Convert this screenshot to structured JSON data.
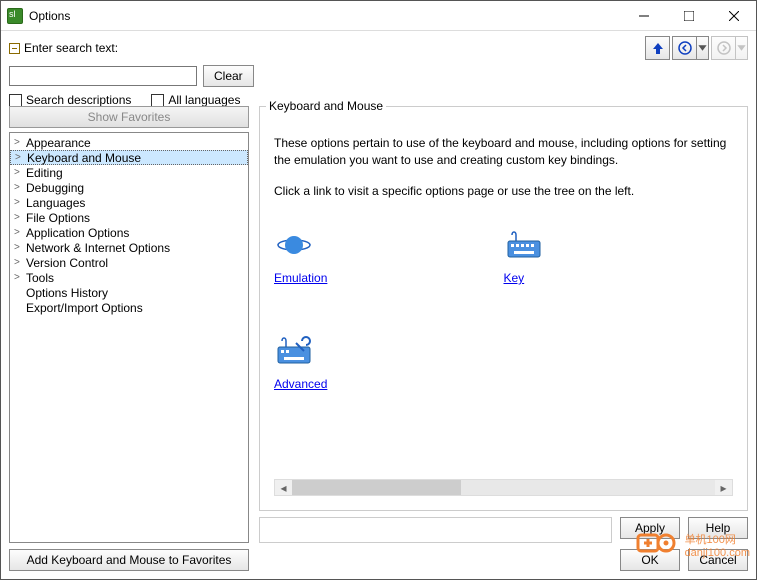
{
  "window": {
    "title": "Options"
  },
  "search": {
    "label": "Enter search text:",
    "clear": "Clear",
    "desc_chk": "Search descriptions",
    "lang_chk": "All languages",
    "favorites_btn": "Show Favorites",
    "add_fav_btn": "Add Keyboard and Mouse to Favorites"
  },
  "tree": [
    {
      "label": "Appearance",
      "expandable": true,
      "selected": false
    },
    {
      "label": "Keyboard and Mouse",
      "expandable": true,
      "selected": true
    },
    {
      "label": "Editing",
      "expandable": true,
      "selected": false
    },
    {
      "label": "Debugging",
      "expandable": true,
      "selected": false
    },
    {
      "label": "Languages",
      "expandable": true,
      "selected": false
    },
    {
      "label": "File Options",
      "expandable": true,
      "selected": false
    },
    {
      "label": "Application Options",
      "expandable": true,
      "selected": false
    },
    {
      "label": "Network & Internet Options",
      "expandable": true,
      "selected": false
    },
    {
      "label": "Version Control",
      "expandable": true,
      "selected": false
    },
    {
      "label": "Tools",
      "expandable": true,
      "selected": false
    },
    {
      "label": "Options History",
      "expandable": false,
      "selected": false
    },
    {
      "label": "Export/Import Options",
      "expandable": false,
      "selected": false
    }
  ],
  "panel": {
    "title": "Keyboard and Mouse",
    "desc1": "These options pertain to use of the keyboard and mouse, including options for setting the emulation you want to use and creating custom key bindings.",
    "desc2": "Click a link to visit a specific options page or use the tree on the left.",
    "links": [
      {
        "label": "Emulation",
        "icon": "saturn"
      },
      {
        "label": "Key",
        "icon": "keyboard"
      },
      {
        "label": "Advanced",
        "icon": "keyboard-wrench"
      }
    ]
  },
  "buttons": {
    "apply": "Apply",
    "help": "Help",
    "ok": "OK",
    "cancel": "Cancel"
  },
  "watermark": "单机100网\ndanji100.com"
}
